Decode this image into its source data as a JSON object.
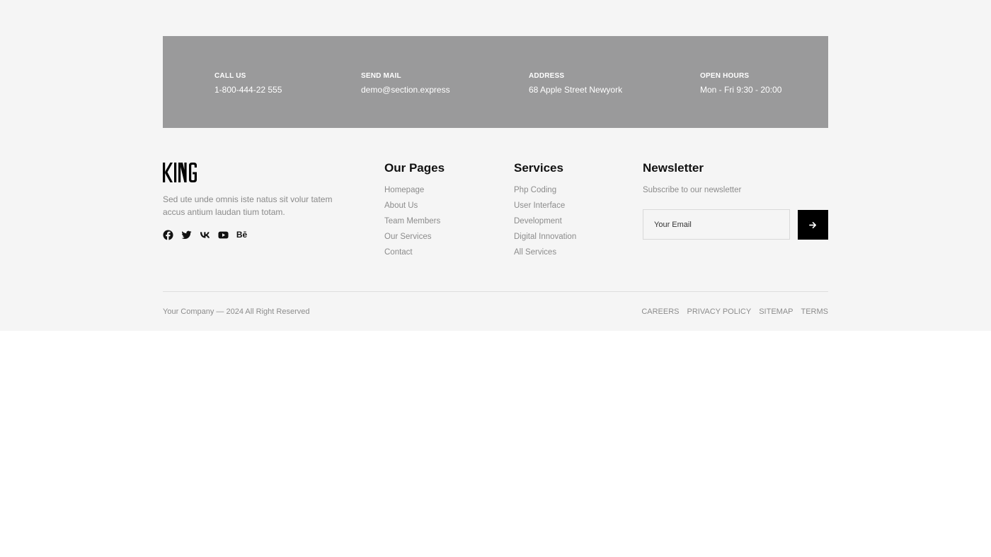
{
  "contact": {
    "call": {
      "label": "CALL US",
      "value": "1-800-444-22 555"
    },
    "mail": {
      "label": "SEND MAIL",
      "value": "demo@section.express"
    },
    "address": {
      "label": "ADDRESS",
      "value": "68 Apple Street Newyork"
    },
    "hours": {
      "label": "OPEN HOURS",
      "value": "Mon - Fri 9:30 - 20:00"
    }
  },
  "brand": {
    "logo": "KING",
    "description": "Sed ute unde omnis iste natus sit volur tatem accus antium laudan tium totam."
  },
  "social": [
    "facebook-icon",
    "twitter-icon",
    "vk-icon",
    "youtube-icon",
    "behance-icon"
  ],
  "social_behance_text": "Bē",
  "pages": {
    "title": "Our Pages",
    "links": [
      "Homepage",
      "About Us",
      "Team Members",
      "Our Services",
      "Contact"
    ]
  },
  "services": {
    "title": "Services",
    "links": [
      "Php Coding",
      "User Interface",
      "Development",
      "Digital Innovation",
      "All Services"
    ]
  },
  "newsletter": {
    "title": "Newsletter",
    "subtitle": "Subscribe to our newsletter",
    "placeholder": "Your Email",
    "submit_icon": "arrow-right-icon"
  },
  "bottom": {
    "copyright": "Your Company — 2024 All Right Reserved",
    "links": [
      "CAREERS",
      "PRIVACY POLICY",
      "SITEMAP",
      "TERMS"
    ]
  },
  "colors": {
    "contact_bar": "#9a9a9b",
    "footer_bg": "#f5f5f5",
    "button": "#000000"
  }
}
